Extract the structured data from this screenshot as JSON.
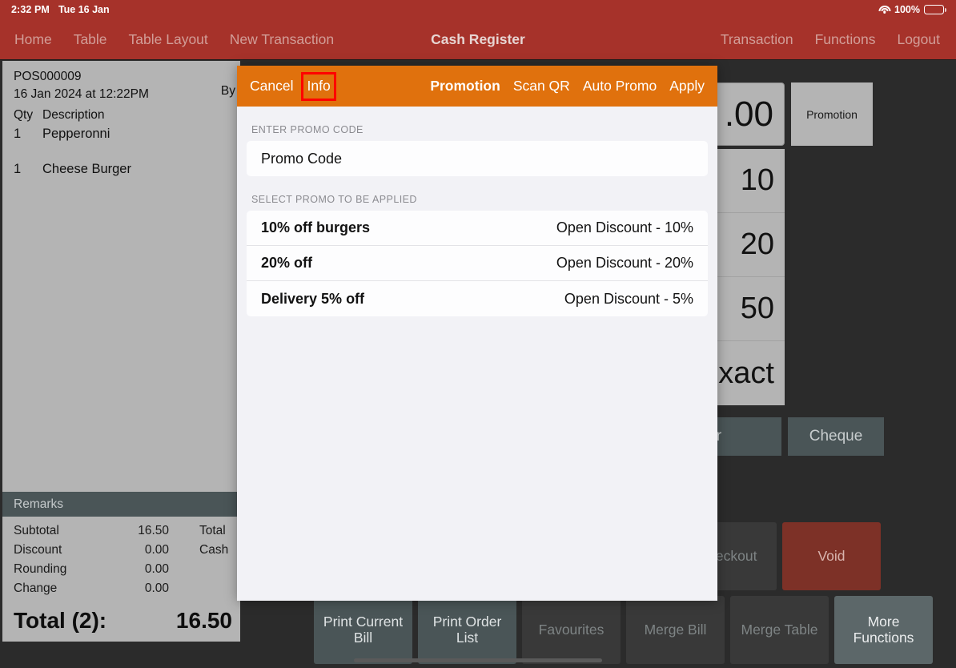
{
  "status_bar": {
    "time": "2:32 PM",
    "date": "Tue 16 Jan",
    "battery_percent": "100%",
    "wifi_icon": "wifi-icon",
    "battery_icon": "battery-full-icon"
  },
  "nav": {
    "title": "Cash Register",
    "left_items": [
      "Home",
      "Table",
      "Table Layout",
      "New Transaction"
    ],
    "right_items": [
      "Transaction",
      "Functions",
      "Logout"
    ],
    "bar_color": "#a6322a"
  },
  "receipt": {
    "order_id": "POS000009",
    "datetime": "16 Jan 2024 at 12:22PM",
    "by_label": "By",
    "col_qty": "Qty",
    "col_description": "Description",
    "lines": [
      {
        "qty": "1",
        "description": "Pepperonni"
      },
      {
        "qty": "1",
        "description": "Cheese Burger"
      }
    ],
    "remarks_label": "Remarks",
    "summary": [
      {
        "label": "Subtotal",
        "value": "16.50",
        "label2": "Total"
      },
      {
        "label": "Discount",
        "value": "0.00",
        "label2": "Cash"
      },
      {
        "label": "Rounding",
        "value": "0.00",
        "label2": ""
      },
      {
        "label": "Change",
        "value": "0.00",
        "label2": ""
      }
    ],
    "grand_label": "Total (2):",
    "grand_value": "16.50"
  },
  "keypad": {
    "amount_display": ".00",
    "promotion_label": "Promotion",
    "quick_amounts": [
      "10",
      "20",
      "50",
      "xact"
    ],
    "payment_buttons": [
      "oucher",
      "Cheque"
    ]
  },
  "actions": {
    "row1": [
      {
        "label": "Checkout",
        "state": "disabled"
      },
      {
        "label": "Void",
        "state": "void"
      }
    ],
    "row2": [
      {
        "label": "Print Current Bill",
        "state": "enabled"
      },
      {
        "label": "Print Order List",
        "state": "enabled"
      },
      {
        "label": "Favourites",
        "state": "disabled"
      },
      {
        "label": "Merge Bill",
        "state": "disabled"
      },
      {
        "label": "Merge Table",
        "state": "disabled"
      },
      {
        "label": "More Functions",
        "state": "more"
      }
    ]
  },
  "modal": {
    "bar_color": "#e0710d",
    "cancel_label": "Cancel",
    "info_label": "Info",
    "title": "Promotion",
    "scan_qr_label": "Scan QR",
    "auto_promo_label": "Auto Promo",
    "apply_label": "Apply",
    "highlight_color": "#ff0000",
    "enter_promo_section_label": "ENTER PROMO CODE",
    "promo_code_value": "Promo Code",
    "promo_code_placeholder": "Promo Code",
    "select_promo_section_label": "SELECT PROMO TO BE APPLIED",
    "promos": [
      {
        "name": "10% off burgers",
        "value": "Open Discount - 10%"
      },
      {
        "name": "20% off",
        "value": "Open Discount - 20%"
      },
      {
        "name": "Delivery 5% off",
        "value": "Open Discount - 5%"
      }
    ]
  }
}
